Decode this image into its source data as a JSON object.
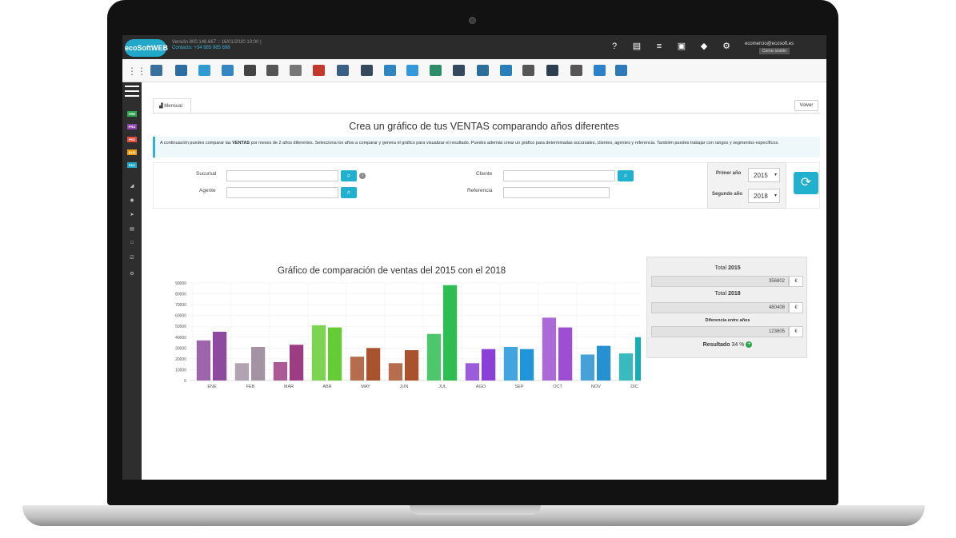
{
  "app": {
    "logo": "ecoSoftWEB",
    "version_line": "Versión 800.148.667 :: 16/01/2020 13:00 |",
    "contact_line": "Contacto: +34 985 985 898",
    "user_email": "ecomercio@ecosoft.es",
    "logout_label": "Cerrar sesión"
  },
  "sidebar": {
    "badges": [
      {
        "label": "PRE",
        "color": "#2ea44f"
      },
      {
        "label": "PRO",
        "color": "#8e44ad"
      },
      {
        "label": "PED",
        "color": "#e74c3c"
      },
      {
        "label": "ALB",
        "color": "#f39c12"
      },
      {
        "label": "FAC",
        "color": "#1fa9c4"
      }
    ]
  },
  "main": {
    "tab_label": "Mensual",
    "back_label": "Volver",
    "title": "Crea un gráfico de tus VENTAS comparando años diferentes",
    "info_pre": "A continuación puedes comparar las ",
    "info_bold": "VENTAS",
    "info_post": " por meses de 2 años diferentes. Selecciona los años a comparar y genera el gráfico para visualizar el resultado. Puedes además crear un gráfico para determinadas sucursales, clientes, agentes y referencia. También puedes trabajar con rangos y segmentos específicos.",
    "filters": {
      "sucursal_label": "Sucursal",
      "agente_label": "Agente",
      "cliente_label": "Cliente",
      "referencia_label": "Referencia",
      "first_year_label": "Primer año",
      "second_year_label": "Segundo año",
      "first_year": "2015",
      "second_year": "2018"
    },
    "chart_title": "Gráfico de comparación de ventas del 2015 con el 2018"
  },
  "totals": {
    "total_label": "Total",
    "year1": "2015",
    "value1": "356802",
    "year2": "2018",
    "value2": "480408",
    "diff_label": "Diferencia entre años",
    "diff_value": "123605",
    "currency": "€",
    "result_label": "Resultado",
    "result_value": "34 %"
  },
  "chart_data": {
    "type": "bar",
    "title": "Gráfico de comparación de ventas del 2015 con el 2018",
    "categories": [
      "ENE",
      "FEB",
      "MAR",
      "ABR",
      "MAY",
      "JUN",
      "JUL",
      "AGO",
      "SEP",
      "OCT",
      "NOV",
      "DIC"
    ],
    "series": [
      {
        "values": [
          37000,
          16000,
          17000,
          51000,
          22000,
          16000,
          43000,
          16000,
          31000,
          58000,
          24000,
          25000
        ]
      },
      {
        "values": [
          45000,
          31000,
          33000,
          49000,
          30000,
          28000,
          88000,
          29000,
          29000,
          49000,
          32000,
          40000
        ]
      }
    ],
    "colors": [
      "#8e4a9e",
      "#a393a3",
      "#9c3d83",
      "#66cc33",
      "#a8532e",
      "#a8532e",
      "#2ebd52",
      "#8a3fd6",
      "#2195d9",
      "#9d4fd1",
      "#2691d0",
      "#16aeb4"
    ],
    "ylim": [
      0,
      90000
    ],
    "yticks": [
      0,
      10000,
      20000,
      30000,
      40000,
      50000,
      60000,
      70000,
      80000,
      90000
    ],
    "grid": true
  }
}
